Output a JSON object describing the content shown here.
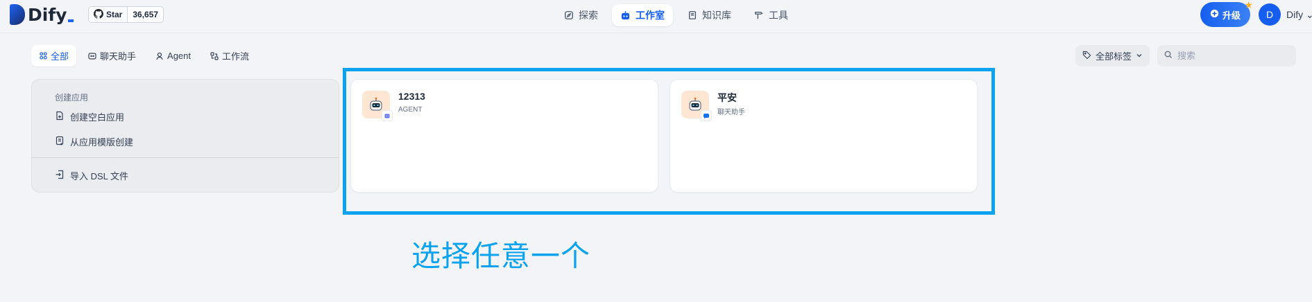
{
  "app": {
    "brand": "Dify",
    "brand_suffix": "."
  },
  "github": {
    "star_label": "Star",
    "count": "36,657"
  },
  "nav": [
    {
      "label": "探索",
      "icon": "compass-icon"
    },
    {
      "label": "工作室",
      "icon": "robot-icon",
      "active": true
    },
    {
      "label": "知识库",
      "icon": "book-icon"
    },
    {
      "label": "工具",
      "icon": "hammer-icon"
    }
  ],
  "header": {
    "upgrade_label": "升级",
    "avatar_initial": "D",
    "user_name": "Dify"
  },
  "tabs": [
    {
      "label": "全部",
      "icon": "grid-icon",
      "active": true
    },
    {
      "label": "聊天助手",
      "icon": "chat-icon"
    },
    {
      "label": "Agent",
      "icon": "agent-icon"
    },
    {
      "label": "工作流",
      "icon": "workflow-icon"
    }
  ],
  "filters": {
    "tag_label": "全部标签",
    "search_placeholder": "搜索"
  },
  "create": {
    "title": "创建应用",
    "blank_label": "创建空白应用",
    "template_label": "从应用模版创建",
    "import_label": "导入 DSL 文件"
  },
  "apps": [
    {
      "name": "12313",
      "type": "AGENT"
    },
    {
      "name": "平安",
      "type": "聊天助手"
    }
  ],
  "annotation": "选择任意一个",
  "colors": {
    "accent": "#155eef",
    "highlight": "#0ba2ef",
    "background": "#f2f4f7"
  }
}
